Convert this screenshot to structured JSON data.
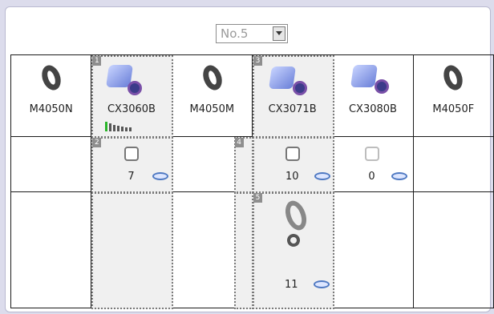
{
  "dropdown": {
    "value": "No.5"
  },
  "columns": [
    {
      "label": "M4050N",
      "icon": "ring-icon"
    },
    {
      "label": "CX3060B",
      "icon": "lens-icon"
    },
    {
      "label": "M4050M",
      "icon": "ring-icon"
    },
    {
      "label": "CX3071B",
      "icon": "lens-icon"
    },
    {
      "label": "CX3080B",
      "icon": "lens-icon"
    },
    {
      "label": "M4050F",
      "icon": "ring-icon"
    }
  ],
  "slots": {
    "s1": "1",
    "s2": "2",
    "s3": "3",
    "s4": "4",
    "s5": "5"
  },
  "counts": {
    "c2": "7",
    "c4": "10",
    "c5": "0",
    "c6": "11"
  },
  "colors": {
    "background": "#dcdcec",
    "selection": "#f0f0f0",
    "level_green": "#28b428"
  }
}
